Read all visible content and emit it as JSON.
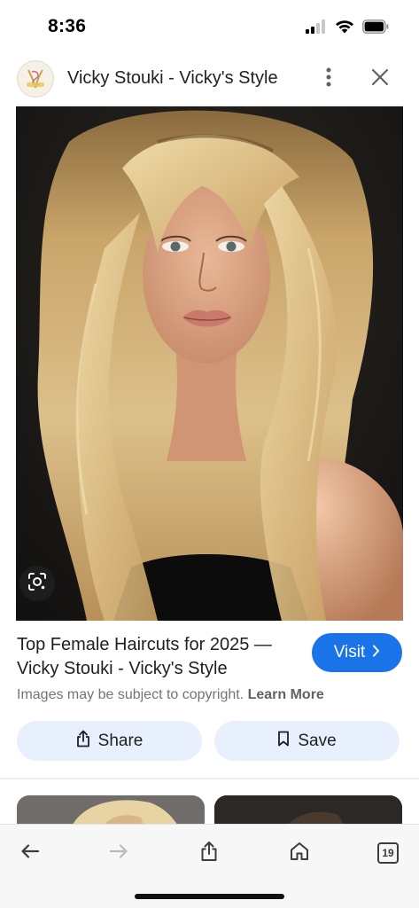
{
  "status_bar": {
    "time": "8:36",
    "icons": [
      "cellular-signal-icon",
      "wifi-icon",
      "battery-icon"
    ]
  },
  "header": {
    "site_title": "Vicky Stouki - Vicky's Style",
    "favicon": "vicky-style-logo",
    "more_icon": "more-vert-icon",
    "close_icon": "close-icon"
  },
  "image": {
    "description_icon": "google-lens-icon"
  },
  "result": {
    "title": "Top Female Haircuts for 2025 — Vicky Stouki - Vicky's Style",
    "visit_label": "Visit",
    "copyright_text": "Images may be subject to copyright.",
    "learn_more_label": "Learn More"
  },
  "actions": {
    "share_label": "Share",
    "save_label": "Save"
  },
  "toolbar": {
    "back_icon": "back-arrow-icon",
    "forward_icon": "forward-arrow-icon",
    "share_icon": "share-icon",
    "home_icon": "home-icon",
    "tab_count": "19"
  },
  "colors": {
    "accent": "#1a73e8",
    "chip_bg": "#e8f0fe",
    "muted_text": "#70757a"
  }
}
